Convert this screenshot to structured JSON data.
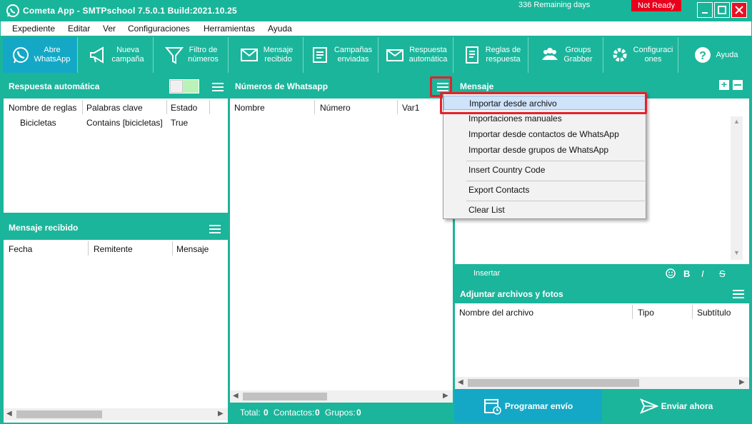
{
  "window": {
    "title": "Cometa App - SMTPschool 7.5.0.1 Build:2021.10.25",
    "remaining": "336 Remaining days",
    "status": "Not Ready"
  },
  "menubar": [
    "Expediente",
    "Editar",
    "Ver",
    "Configuraciones",
    "Herramientas",
    "Ayuda"
  ],
  "toolbar": [
    {
      "label": "Abre\nWhatsApp",
      "icon": "whatsapp-icon"
    },
    {
      "label": "Nueva\ncampaña",
      "icon": "megaphone-icon"
    },
    {
      "label": "Filtro de\nnúmeros",
      "icon": "filter-icon"
    },
    {
      "label": "Mensaje\nrecibido",
      "icon": "mail-icon"
    },
    {
      "label": "Campañas\nenviadas",
      "icon": "campaigns-icon"
    },
    {
      "label": "Respuesta\nautomática",
      "icon": "auto-reply-icon"
    },
    {
      "label": "Reglas de\nrespuesta",
      "icon": "rules-icon"
    },
    {
      "label": "Groups\nGrabber",
      "icon": "groups-icon"
    },
    {
      "label": "Configuraci\nones",
      "icon": "gear-icon"
    },
    {
      "label": "Ayuda",
      "icon": "help-icon"
    }
  ],
  "auto_reply": {
    "title": "Respuesta automática",
    "columns": [
      "Nombre de reglas",
      "Palabras clave",
      "Estado"
    ],
    "rows": [
      [
        "Bicicletas",
        "Contains [bicicletas]",
        "True"
      ]
    ]
  },
  "received": {
    "title": "Mensaje recibido",
    "columns": [
      "Fecha",
      "Remitente",
      "Mensaje"
    ]
  },
  "numbers": {
    "title": "Números de Whatsapp",
    "columns": [
      "Nombre",
      "Número",
      "Var1"
    ],
    "footer": {
      "total_label": "Total:",
      "total": "0",
      "contacts_label": "Contactos:",
      "contacts": "0",
      "groups_label": "Grupos:",
      "groups": "0"
    }
  },
  "message": {
    "title": "Mensaje",
    "insert_label": "Insertar",
    "format": {
      "bold": "B",
      "italic": "I",
      "strike": "S"
    }
  },
  "attachments": {
    "title": "Adjuntar archivos y fotos",
    "columns": [
      "Nombre del archivo",
      "Tipo",
      "Subtítulo"
    ]
  },
  "dropdown": [
    "Importar desde archivo",
    "Importaciones manuales",
    "Importar desde contactos de WhatsApp",
    "Importar desde grupos de WhatsApp",
    "Insert Country Code",
    "Export Contacts",
    "Clear List"
  ],
  "actions": {
    "schedule": "Programar envío",
    "send_now": "Enviar ahora"
  },
  "colors": {
    "accent": "#1bb59b",
    "active": "#14a8c6",
    "danger": "#e81123",
    "highlight": "#e5212b"
  }
}
